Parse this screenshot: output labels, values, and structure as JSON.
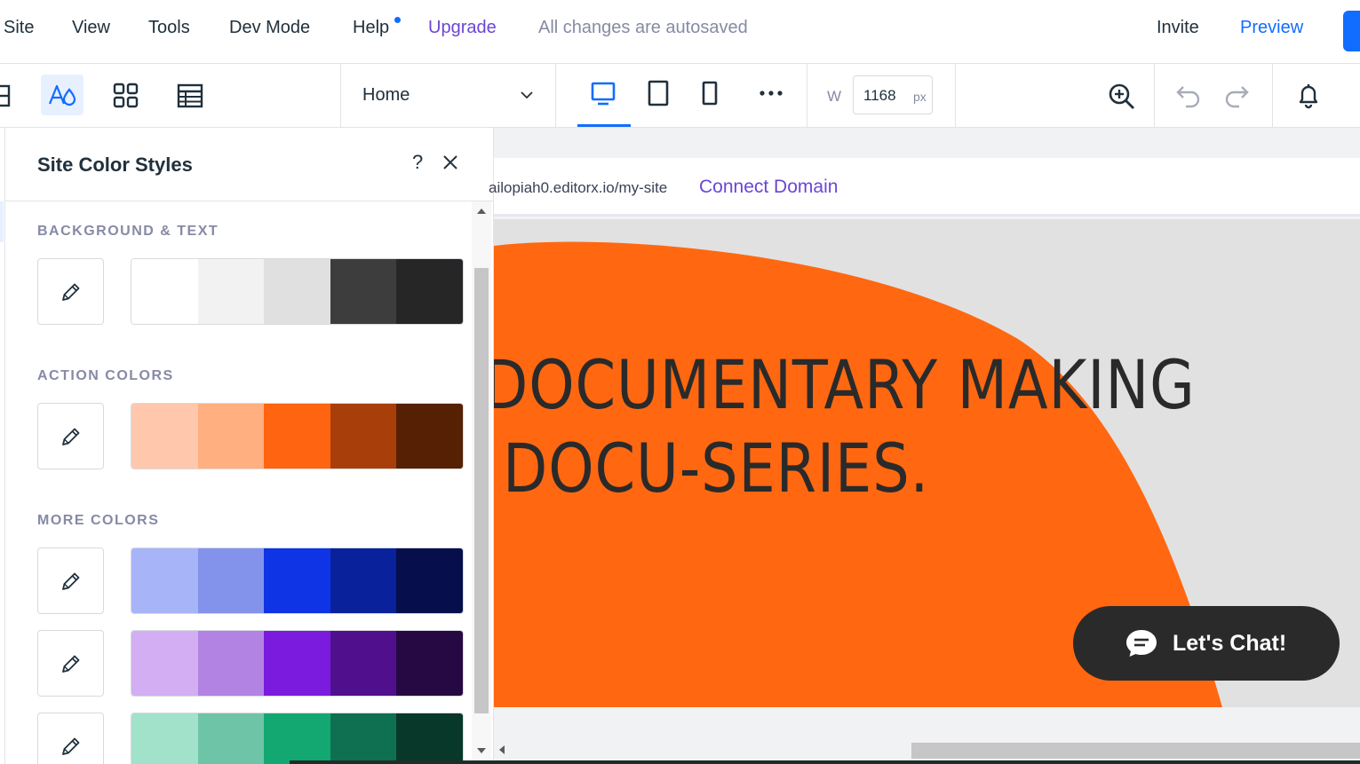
{
  "menubar": {
    "items": [
      "Site",
      "View",
      "Tools",
      "Dev Mode",
      "Help"
    ],
    "upgrade": "Upgrade",
    "status": "All changes are autosaved",
    "invite": "Invite",
    "preview": "Preview"
  },
  "toolbar": {
    "page": "Home",
    "width_label": "W",
    "width_value": "1168",
    "width_unit": "px",
    "active_device": "desktop"
  },
  "panel": {
    "title": "Site Color Styles",
    "help": "?",
    "sections": [
      {
        "label": "BACKGROUND & TEXT",
        "palettes": [
          [
            "#ffffff",
            "#f2f2f2",
            "#e0e0e0",
            "#3d3d3d",
            "#262626"
          ]
        ]
      },
      {
        "label": "ACTION COLORS",
        "palettes": [
          [
            "#ffc8ad",
            "#ffaf80",
            "#ff6511",
            "#a83f0a",
            "#562005"
          ]
        ]
      },
      {
        "label": "MORE COLORS",
        "palettes": [
          [
            "#a7b5f8",
            "#8393ec",
            "#0f34e6",
            "#09229c",
            "#060f4b"
          ],
          [
            "#d4aef2",
            "#b283e2",
            "#7b1bde",
            "#50108d",
            "#260942"
          ],
          [
            "#a2e2cb",
            "#6ec4a6",
            "#13a871",
            "#0e7051",
            "#07382a"
          ]
        ]
      }
    ]
  },
  "canvas": {
    "url": "ailopiah0.editorx.io/my-site",
    "connect_domain": "Connect Domain",
    "hero_line1": "DOCUMENTARY MAKING",
    "hero_line2": "DOCU-SERIES.",
    "chat_label": "Let's Chat!",
    "accent_color": "#ff6811",
    "background_color": "#e1e1e1"
  }
}
